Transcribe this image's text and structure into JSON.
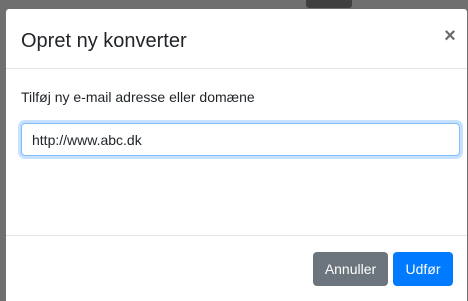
{
  "dialog": {
    "title": "Opret ny konverter",
    "close_label": "×"
  },
  "form": {
    "label": "Tilføj ny e-mail adresse eller domæne",
    "input_value": "http://www.abc.dk"
  },
  "footer": {
    "cancel_label": "Annuller",
    "submit_label": "Udfør"
  },
  "colors": {
    "primary": "#007bff",
    "secondary": "#6c757d",
    "backdrop": "#6f6f6f"
  }
}
